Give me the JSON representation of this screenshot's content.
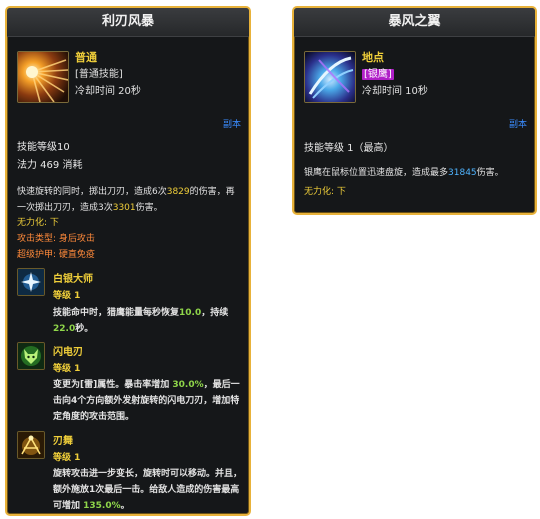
{
  "left": {
    "title": "利刃风暴",
    "skill_type": "普通",
    "skill_tag": "[普通技能]",
    "cooldown": "冷却时间 20秒",
    "copy": "副本",
    "level": "技能等级10",
    "mana": "法力 469 消耗",
    "desc": {
      "p1": "快速旋转的同时，掷出刀刃，造成6次",
      "v1": "3829",
      "p2": "的伤害，再一次掷出刀刃，造成3次",
      "v2": "3301",
      "p3": "伤害。"
    },
    "invincible": "无力化: 下",
    "attack_type": "攻击类型: 身后攻击",
    "super_armor": "超级护甲: 硬直免疫",
    "runes": [
      {
        "name": "白银大师",
        "level": "等级 1",
        "desc": {
          "p1": "技能命中时，猎鹰能量每秒恢复",
          "v1": "10.0",
          "p2": "，持续",
          "v2": "22.0",
          "p3": "秒。"
        }
      },
      {
        "name": "闪电刃",
        "level": "等级 1",
        "desc": {
          "p1": "变更为[雷]属性。暴击率增加 ",
          "v1": "30.0%",
          "p2": "，最后一击向4个方向额外发射旋转的闪电刀刃，增加特定角度的攻击范围。"
        }
      },
      {
        "name": "刃舞",
        "level": "等级 1",
        "desc": {
          "p1": "旋转攻击进一步变长，旋转时可以移动。并且，额外施放1次最后一击。给敌人造成的伤害最高可增加 ",
          "v1": "135.0%",
          "p2": "。"
        }
      }
    ]
  },
  "right": {
    "title": "暴风之翼",
    "skill_type": "地点",
    "skill_tag": "[银鹰]",
    "cooldown": "冷却时间 10秒",
    "copy": "副本",
    "level": "技能等级 1（最高）",
    "desc": {
      "p1": "银鹰在鼠标位置迅速盘旋，造成最多",
      "v1": "31845",
      "p2": "伤害。"
    },
    "invincible": "无力化: 下"
  },
  "colors": {
    "border": "#e8b23a",
    "panel_bg": "#151719",
    "gold_text": "#f0cf3a",
    "link_blue": "#3a8cff",
    "value_blue": "#4fb4ff",
    "green_value": "#8fd64a",
    "tag_magenta": "#b020c8"
  },
  "icons": {
    "left_skill": "blade-storm-icon",
    "right_skill": "storm-wings-icon",
    "rune1": "silver-star-icon",
    "rune2": "wolf-head-icon",
    "rune3": "blade-dance-icon"
  }
}
